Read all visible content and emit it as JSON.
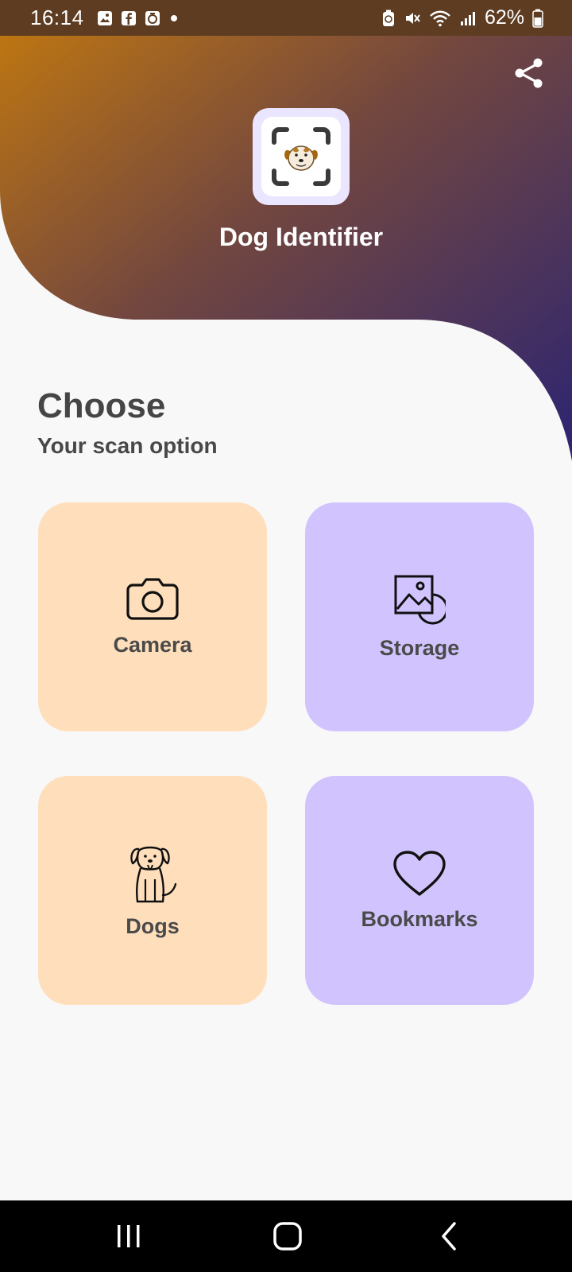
{
  "status_bar": {
    "time": "16:14",
    "battery": "62%",
    "icons_left": [
      "gallery-icon",
      "facebook-icon",
      "clock-app-icon",
      "dot-icon"
    ],
    "icons_right": [
      "battery-saver-icon",
      "mute-icon",
      "wifi-icon",
      "signal-icon",
      "battery-icon"
    ]
  },
  "header": {
    "title": "Dog Identifier",
    "gradient_colors": [
      "#c0770f",
      "#7a4f3a",
      "#2e2470"
    ]
  },
  "main": {
    "heading": "Choose",
    "subheading": "Your scan option",
    "options": [
      {
        "label": "Camera",
        "icon": "camera-icon",
        "color": "#ffdfbb"
      },
      {
        "label": "Storage",
        "icon": "image-icon",
        "color": "#d1c4fe"
      },
      {
        "label": "Dogs",
        "icon": "dog-icon",
        "color": "#ffdfbb"
      },
      {
        "label": "Bookmarks",
        "icon": "heart-icon",
        "color": "#d1c4fe"
      }
    ]
  },
  "nav_bar": {
    "buttons": [
      "recents-icon",
      "home-icon",
      "back-icon"
    ]
  }
}
